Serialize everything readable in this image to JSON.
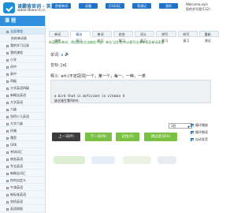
{
  "header": {
    "title": "读霸背单词 - 英语单词",
    "url": "www.dbword.cn",
    "nav": [
      "首频单词",
      "读霸",
      "打印词汇",
      "背诵记",
      "我的"
    ],
    "welcome": "Welcome,xiyh",
    "user_stat": "您的学号是(112)"
  },
  "sidebar": {
    "heading": "课 程",
    "items": [
      {
        "label": "全部课程",
        "level": 1,
        "active": true,
        "icon": "box"
      },
      {
        "label": "你的单词表",
        "level": 2,
        "active": false,
        "icon": ""
      },
      {
        "label": "我的学习记录",
        "level": 1,
        "active": false,
        "icon": "box"
      },
      {
        "label": "我的课程",
        "level": 1,
        "active": false,
        "icon": "box"
      },
      {
        "label": "小学",
        "level": 1,
        "active": false,
        "icon": "box"
      },
      {
        "label": "初中",
        "level": 1,
        "active": false,
        "icon": "box"
      },
      {
        "label": "高中",
        "level": 1,
        "active": false,
        "icon": "box"
      },
      {
        "label": "四级",
        "level": 1,
        "active": false,
        "icon": "box"
      },
      {
        "label": "大学英语四级",
        "level": 1,
        "active": false,
        "icon": "box"
      },
      {
        "label": "新概念英语",
        "level": 1,
        "active": false,
        "icon": "box"
      },
      {
        "label": "大学英语",
        "level": 1,
        "active": false,
        "icon": "box"
      },
      {
        "label": "六级",
        "level": 1,
        "active": false,
        "icon": "box"
      },
      {
        "label": "剑桥少儿英语",
        "level": 1,
        "active": false,
        "icon": "box"
      },
      {
        "label": "大学六级",
        "level": 1,
        "active": false,
        "icon": "box"
      },
      {
        "label": "托福",
        "level": 1,
        "active": false,
        "icon": "box"
      },
      {
        "label": "雅思",
        "level": 1,
        "active": false,
        "icon": "box"
      },
      {
        "label": "GRE",
        "level": 1,
        "active": false,
        "icon": "box"
      },
      {
        "label": "考研词汇",
        "level": 1,
        "active": false,
        "icon": "box"
      },
      {
        "label": "商务英语",
        "level": 1,
        "active": false,
        "icon": "box"
      },
      {
        "label": "专业英语",
        "level": 1,
        "active": false,
        "icon": "box"
      },
      {
        "label": "新概念词汇",
        "level": 1,
        "active": false,
        "icon": "box"
      },
      {
        "label": "你的自定义",
        "level": 1,
        "active": false,
        "icon": "box"
      },
      {
        "label": "牛津英语",
        "level": 1,
        "active": false,
        "icon": "box"
      },
      {
        "label": "新标准英语",
        "level": 1,
        "active": false,
        "icon": "box"
      },
      {
        "label": "剑桥英语",
        "level": 1,
        "active": false,
        "icon": "box"
      },
      {
        "label": "英语周报",
        "level": 1,
        "active": false,
        "icon": "box"
      },
      {
        "label": "新课标英语",
        "level": 1,
        "active": false,
        "icon": "box"
      }
    ]
  },
  "tabs": [
    "单词浏览",
    "精选复习",
    "单词学习",
    "综合复习",
    "词义复习",
    "拼写复习",
    "听写复习",
    "重新测试"
  ],
  "notice": "听读提示单词，然后用本方法按住不放！单击'记住'后中以便写出本单词及单词读音",
  "word": {
    "label": "单词:",
    "value": "a",
    "phonetic_label": "音标:",
    "phonetic": "[ə]",
    "meaning_label": "释义:",
    "meaning": "art.(不定冠词)一个，某一个，每一，一种，一类"
  },
  "example": {
    "en": "a bird that is deficient in vitamin A",
    "cn": "缺乏维生素A的鸟"
  },
  "select": {
    "value": "1秒"
  },
  "checks": [
    {
      "label": "循环播放",
      "checked": true
    },
    {
      "label": "循环朗读",
      "checked": true
    },
    {
      "label": "自动发音",
      "checked": true
    }
  ],
  "buttons": {
    "prev": "上一词(P)",
    "next": "下一词(N)",
    "mark": "记住(R)",
    "skip": "跳过此词(S)"
  },
  "colors": {
    "brand": "#1e73c8",
    "sidebar_head": "#2f8fdc",
    "green": "#7ac143",
    "dark": "#3c3c3c"
  }
}
